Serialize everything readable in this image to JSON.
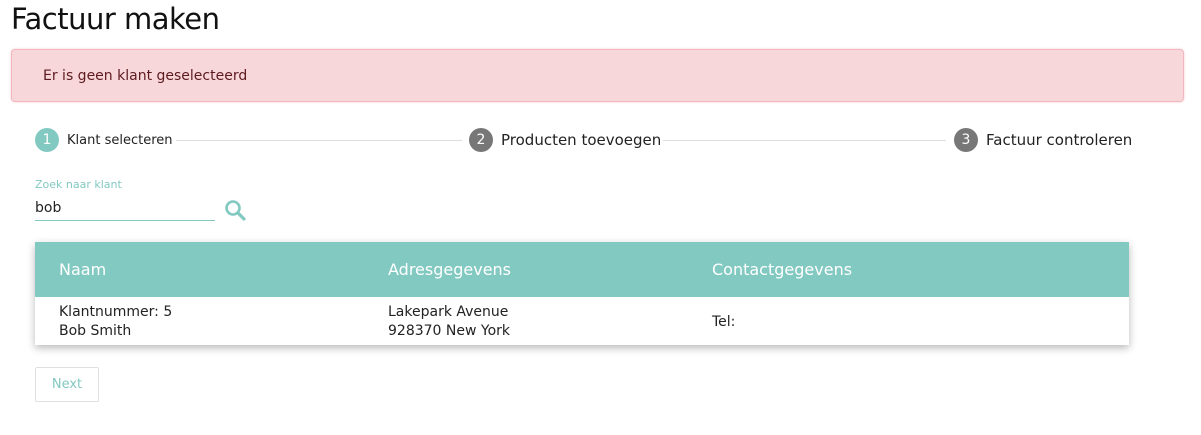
{
  "page": {
    "title": "Factuur maken"
  },
  "alert": {
    "message": "Er is geen klant geselecteerd"
  },
  "stepper": {
    "steps": [
      {
        "number": "1",
        "label": "Klant selecteren",
        "active": true
      },
      {
        "number": "2",
        "label": "Producten toevoegen",
        "active": false
      },
      {
        "number": "3",
        "label": "Factuur controleren",
        "active": false
      }
    ]
  },
  "search": {
    "label": "Zoek naar klant",
    "value": "bob",
    "icon": "search-icon"
  },
  "table": {
    "headers": [
      "Naam",
      "Adresgegevens",
      "Contactgegevens"
    ],
    "rows": [
      {
        "customer_number": "Klantnummer: 5",
        "name": "Bob Smith",
        "street": "Lakepark Avenue",
        "city": "928370 New York",
        "phone": "Tel:"
      }
    ]
  },
  "actions": {
    "next_label": "Next"
  },
  "colors": {
    "accent": "#82c9c1",
    "alert_bg": "#f8d7da",
    "alert_border": "#f1b9bf",
    "inactive_step": "#777777"
  }
}
